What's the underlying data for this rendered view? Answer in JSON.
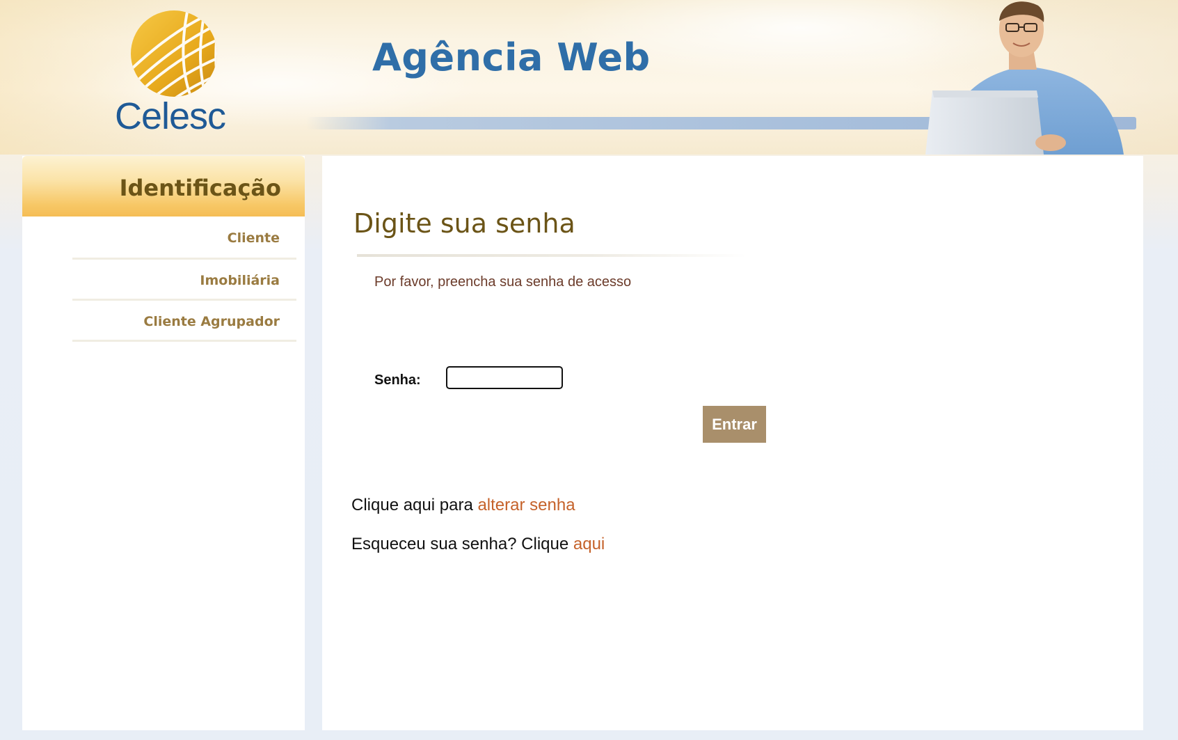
{
  "header": {
    "logo_text": "Celesc",
    "app_title": "Agência Web"
  },
  "sidebar": {
    "title": "Identificação",
    "items": [
      {
        "label": "Cliente"
      },
      {
        "label": "Imobiliária"
      },
      {
        "label": "Cliente Agrupador"
      }
    ]
  },
  "main": {
    "title": "Digite sua senha",
    "instruction": "Por favor, preencha sua senha de acesso",
    "password_label": "Senha:",
    "password_value": "",
    "submit_label": "Entrar",
    "change_password": {
      "prefix": "Clique aqui para ",
      "link": "alterar senha"
    },
    "forgot_password": {
      "prefix": "Esqueceu sua senha? Clique ",
      "link": "aqui"
    }
  },
  "colors": {
    "brand_blue": "#2f6ea8",
    "brand_gold": "#f5bd55",
    "title_brown": "#6b5417",
    "link_orange": "#c5622a",
    "button_tan": "#a98f6b"
  }
}
